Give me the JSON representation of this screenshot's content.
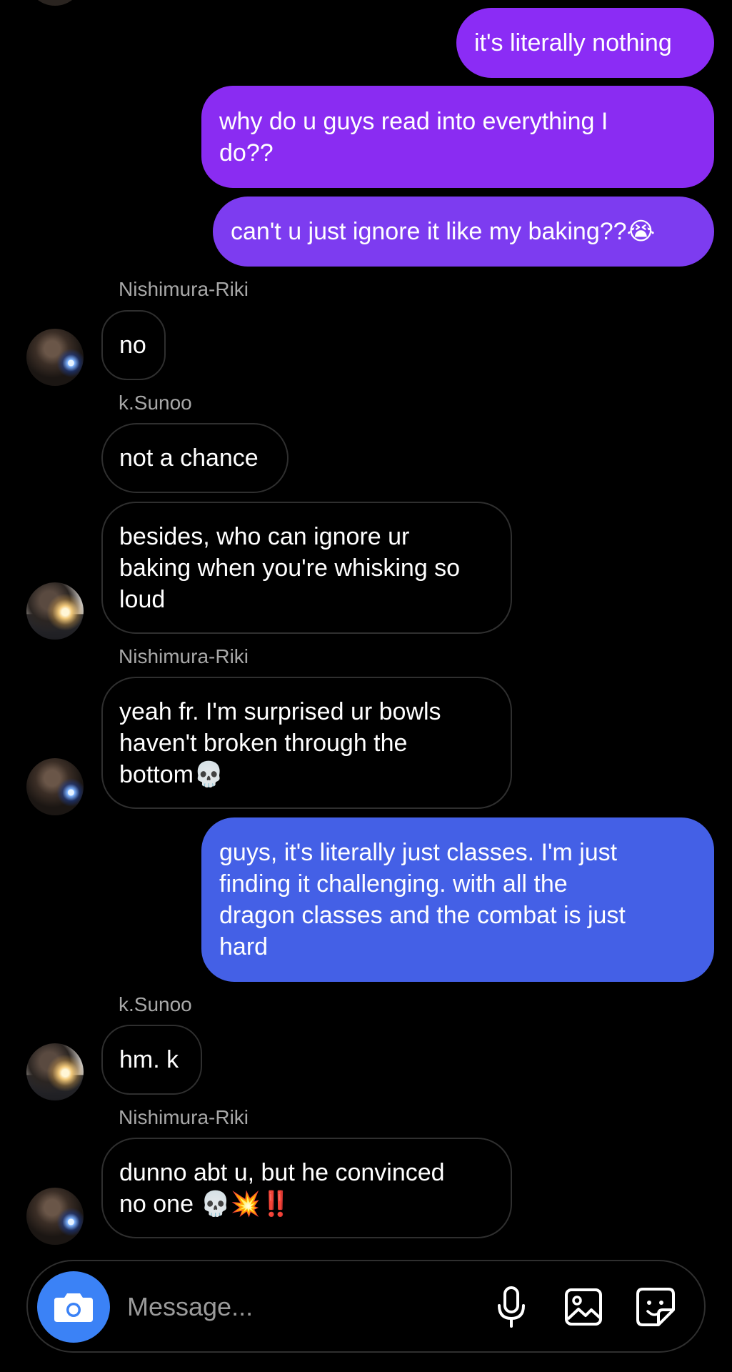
{
  "colors": {
    "background": "#000000",
    "outgoing_purple": "#8b2cf5",
    "outgoing_violet": "#7a3df0",
    "outgoing_blue": "#4460e6",
    "incoming_border": "#2f2f2f",
    "sender_name": "#a8a8a8",
    "camera_button": "#3b82f6"
  },
  "messages": [
    {
      "type": "outgoing",
      "text": "it's literally nothing"
    },
    {
      "type": "outgoing",
      "text": "why do u guys read into everything I\ndo??"
    },
    {
      "type": "outgoing",
      "text": "can't u just ignore it like my baking??😭"
    },
    {
      "type": "sender",
      "text": "Nishimura-Riki"
    },
    {
      "type": "incoming",
      "text": "no"
    },
    {
      "type": "sender",
      "text": "k.Sunoo"
    },
    {
      "type": "incoming",
      "text": "not a chance"
    },
    {
      "type": "incoming",
      "text": "besides, who can ignore ur\nbaking when you're whisking so\nloud"
    },
    {
      "type": "sender",
      "text": "Nishimura-Riki"
    },
    {
      "type": "incoming",
      "text": "yeah fr. I'm surprised ur bowls\nhaven't broken through the\nbottom💀"
    },
    {
      "type": "outgoing",
      "text": "guys, it's literally just classes. I'm just\nfinding it challenging. with all the\ndragon classes and the combat is just\nhard"
    },
    {
      "type": "sender",
      "text": "k.Sunoo"
    },
    {
      "type": "incoming",
      "text": "hm. k"
    },
    {
      "type": "sender",
      "text": "Nishimura-Riki"
    },
    {
      "type": "incoming",
      "text": "dunno abt u, but he convinced\nno one 💀💥‼️"
    }
  ],
  "composer": {
    "placeholder": "Message...",
    "icons": [
      "camera-icon",
      "microphone-icon",
      "gallery-icon",
      "sticker-icon"
    ]
  }
}
